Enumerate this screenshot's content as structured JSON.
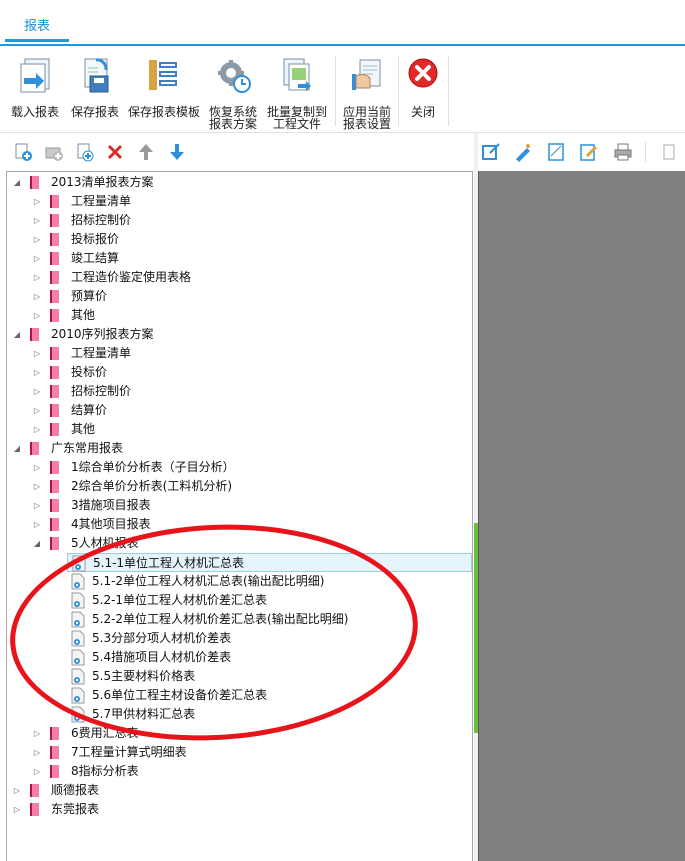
{
  "tab": {
    "label": "报表"
  },
  "ribbon": [
    {
      "label1": "载入报表",
      "label2": "",
      "icon": "load-report-icon"
    },
    {
      "label1": "保存报表",
      "label2": "",
      "icon": "save-report-icon"
    },
    {
      "label1": "保存报表模板",
      "label2": "",
      "icon": "save-template-icon"
    },
    {
      "label1": "恢复系统",
      "label2": "报表方案",
      "icon": "restore-scheme-icon"
    },
    {
      "label1": "批量复制到",
      "label2": "工程文件",
      "icon": "batch-copy-icon"
    },
    {
      "label1": "应用当前",
      "label2": "报表设置",
      "icon": "apply-settings-icon"
    },
    {
      "label1": "关闭",
      "label2": "",
      "icon": "close-icon"
    }
  ],
  "left_toolbar": [
    "add-report-icon",
    "add-folder-icon",
    "copy-report-icon",
    "delete-icon",
    "move-up-icon",
    "move-down-icon"
  ],
  "right_toolbar": [
    "edit-icon",
    "design-icon",
    "page-setup-icon",
    "modify-icon",
    "print-icon",
    "page-icon"
  ],
  "tree": [
    {
      "level": 0,
      "kind": "book",
      "exp": "open",
      "text": "2013清单报表方案"
    },
    {
      "level": 1,
      "kind": "book",
      "exp": "closed",
      "text": "工程量清单"
    },
    {
      "level": 1,
      "kind": "book",
      "exp": "closed",
      "text": "招标控制价"
    },
    {
      "level": 1,
      "kind": "book",
      "exp": "closed",
      "text": "投标报价"
    },
    {
      "level": 1,
      "kind": "book",
      "exp": "closed",
      "text": "竣工结算"
    },
    {
      "level": 1,
      "kind": "book",
      "exp": "closed",
      "text": "工程造价鉴定使用表格"
    },
    {
      "level": 1,
      "kind": "book",
      "exp": "closed",
      "text": "预算价"
    },
    {
      "level": 1,
      "kind": "book",
      "exp": "closed",
      "text": "其他"
    },
    {
      "level": 0,
      "kind": "book",
      "exp": "open",
      "text": "2010序列报表方案"
    },
    {
      "level": 1,
      "kind": "book",
      "exp": "closed",
      "text": "工程量清单"
    },
    {
      "level": 1,
      "kind": "book",
      "exp": "closed",
      "text": "投标价"
    },
    {
      "level": 1,
      "kind": "book",
      "exp": "closed",
      "text": "招标控制价"
    },
    {
      "level": 1,
      "kind": "book",
      "exp": "closed",
      "text": "结算价"
    },
    {
      "level": 1,
      "kind": "book",
      "exp": "closed",
      "text": "其他"
    },
    {
      "level": 0,
      "kind": "book",
      "exp": "open",
      "text": "广东常用报表"
    },
    {
      "level": 1,
      "kind": "book",
      "exp": "closed",
      "text": "1综合单价分析表（子目分析）"
    },
    {
      "level": 1,
      "kind": "book",
      "exp": "closed",
      "text": "2综合单价分析表(工料机分析)"
    },
    {
      "level": 1,
      "kind": "book",
      "exp": "closed",
      "text": "3措施项目报表"
    },
    {
      "level": 1,
      "kind": "book",
      "exp": "closed",
      "text": "4其他项目报表"
    },
    {
      "level": 1,
      "kind": "book",
      "exp": "open",
      "text": "5人材机报表"
    },
    {
      "level": 2,
      "kind": "doc",
      "exp": "none",
      "text": "5.1-1单位工程人材机汇总表",
      "selected": true
    },
    {
      "level": 2,
      "kind": "doc",
      "exp": "none",
      "text": "5.1-2单位工程人材机汇总表(输出配比明细)"
    },
    {
      "level": 2,
      "kind": "doc",
      "exp": "none",
      "text": "5.2-1单位工程人材机价差汇总表"
    },
    {
      "level": 2,
      "kind": "doc",
      "exp": "none",
      "text": "5.2-2单位工程人材机价差汇总表(输出配比明细)"
    },
    {
      "level": 2,
      "kind": "doc",
      "exp": "none",
      "text": "5.3分部分项人材机价差表"
    },
    {
      "level": 2,
      "kind": "doc",
      "exp": "none",
      "text": "5.4措施项目人材机价差表"
    },
    {
      "level": 2,
      "kind": "doc",
      "exp": "none",
      "text": "5.5主要材料价格表"
    },
    {
      "level": 2,
      "kind": "doc",
      "exp": "none",
      "text": "5.6单位工程主材设备价差汇总表"
    },
    {
      "level": 2,
      "kind": "doc",
      "exp": "none",
      "text": "5.7甲供材料汇总表"
    },
    {
      "level": 1,
      "kind": "book",
      "exp": "closed",
      "text": "6费用汇总表"
    },
    {
      "level": 1,
      "kind": "book",
      "exp": "closed",
      "text": "7工程量计算式明细表"
    },
    {
      "level": 1,
      "kind": "book",
      "exp": "closed",
      "text": "8指标分析表"
    },
    {
      "level": 0,
      "kind": "book",
      "exp": "closed",
      "text": "顺德报表"
    },
    {
      "level": 0,
      "kind": "book",
      "exp": "closed",
      "text": "东莞报表"
    }
  ],
  "colors": {
    "accent": "#1a9be0",
    "annotation": "#e8131b",
    "preview_bg": "#808080",
    "splitter": "#6bbf3e"
  }
}
